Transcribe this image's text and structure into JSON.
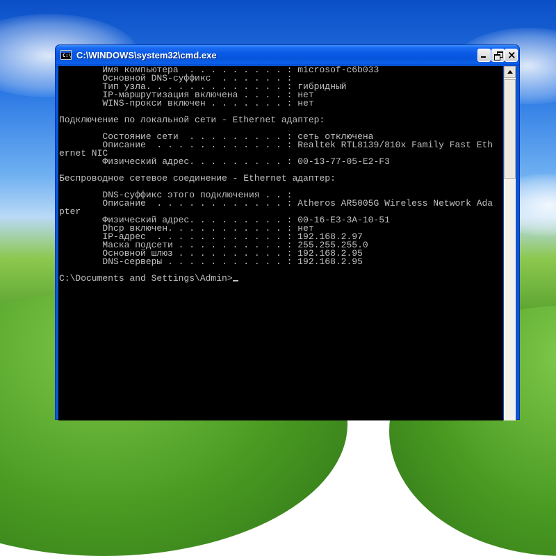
{
  "window": {
    "title": "C:\\WINDOWS\\system32\\cmd.exe",
    "icon": "cmd-icon",
    "controls": [
      "minimize-icon",
      "maximize-icon",
      "close-icon"
    ]
  },
  "console": {
    "lines": [
      "        Имя компьютера  . . . . . . . . . : microsof-c6b033",
      "        Основной DNS-суффикс  . . . . . . :",
      "        Тип узла. . . . . . . . . . . . . : гибридный",
      "        IP-маршрутизация включена . . . . : нет",
      "        WINS-прокси включен . . . . . . . : нет",
      "",
      "Подключение по локальной сети - Ethernet адаптер:",
      "",
      "        Состояние сети  . . . . . . . . . : сеть отключена",
      "        Описание  . . . . . . . . . . . . : Realtek RTL8139/810x Family Fast Eth",
      "ernet NIC",
      "        Физический адрес. . . . . . . . . : 00-13-77-05-E2-F3",
      "",
      "Беспроводное сетевое соединение - Ethernet адаптер:",
      "",
      "        DNS-суффикс этого подключения . . :",
      "        Описание  . . . . . . . . . . . . : Atheros AR5005G Wireless Network Ada",
      "pter",
      "        Физический адрес. . . . . . . . . : 00-16-E3-3A-10-51",
      "        Dhcp включен. . . . . . . . . . . : нет",
      "        IP-адрес  . . . . . . . . . . . . : 192.168.2.97",
      "        Маска подсети . . . . . . . . . . : 255.255.255.0",
      "        Основной шлюз . . . . . . . . . . : 192.168.2.95",
      "        DNS-серверы . . . . . . . . . . . : 192.168.2.95",
      ""
    ],
    "prompt": "C:\\Documents and Settings\\Admin>"
  },
  "colors": {
    "console_bg": "#000000",
    "console_fg": "#c0c0c0",
    "titlebar": "#0a5ae6"
  }
}
